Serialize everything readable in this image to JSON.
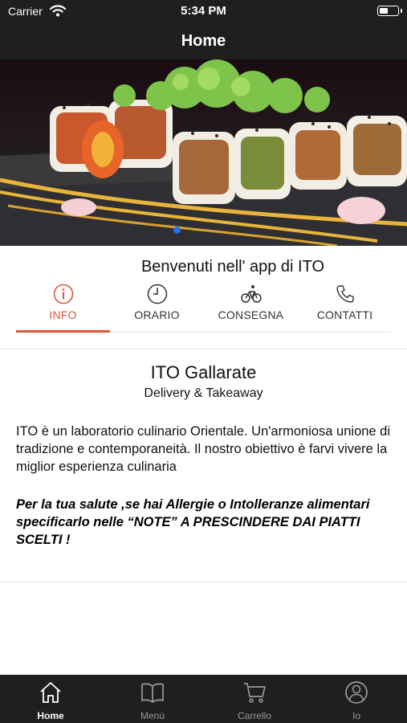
{
  "status_bar": {
    "carrier": "Carrier",
    "time": "5:34 PM"
  },
  "nav": {
    "title": "Home"
  },
  "welcome_text": "Benvenuti nell' app di ITO",
  "tabs": [
    {
      "label": "INFO",
      "icon": "info-icon",
      "active": true
    },
    {
      "label": "ORARIO",
      "icon": "clock-icon",
      "active": false
    },
    {
      "label": "CONSEGNA",
      "icon": "bicycle-icon",
      "active": false
    },
    {
      "label": "CONTATTI",
      "icon": "phone-icon",
      "active": false
    }
  ],
  "info": {
    "name": "ITO Gallarate",
    "subtitle": "Delivery & Takeaway",
    "description": "ITO è un laboratorio culinario Orientale. Un'armoniosa unione di tradizione e contemporaneità. Il nostro obiettivo è farvi vivere la miglior esperienza culinaria",
    "notice": "Per la tua salute ,se hai Allergie o Intolleranze alimentari specificarlo nelle “NOTE” A PRESCINDERE DAI PIATTI SCELTI !"
  },
  "tab_bar": [
    {
      "label": "Home",
      "icon": "home-icon",
      "active": true
    },
    {
      "label": "Menù",
      "icon": "book-icon",
      "active": false
    },
    {
      "label": "Carrello",
      "icon": "cart-icon",
      "active": false
    },
    {
      "label": "Io",
      "icon": "user-icon",
      "active": false
    }
  ],
  "colors": {
    "accent": "#d9583b",
    "bar": "#1f1f1f",
    "page_dot": "#1877f2"
  }
}
